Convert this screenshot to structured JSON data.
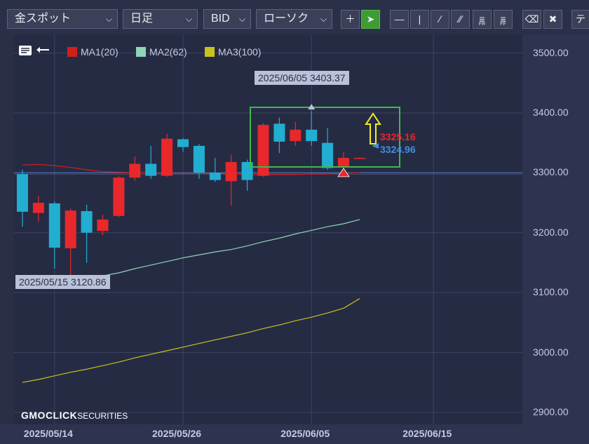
{
  "toolbar": {
    "symbol_select": "金スポット",
    "timeframe_select": "日足",
    "price_type_select": "BID",
    "chart_style_select": "ローソク",
    "label_fr": "FR",
    "label_ff": "FF",
    "label_more": "テ"
  },
  "legend": [
    {
      "name": "MA1(20)",
      "color": "#d1201a"
    },
    {
      "name": "MA2(62)",
      "color": "#8fd3b9"
    },
    {
      "name": "MA3(100)",
      "color": "#c9c21a"
    }
  ],
  "annotations": {
    "high_tooltip": "2025/06/05 3403.37",
    "low_tooltip": "2025/05/15 3120.86",
    "ask_price": "3325.16",
    "bid_price": "3324.96"
  },
  "logo": {
    "brand": "GMOCLICK",
    "suffix": "SECURITIES"
  },
  "colors": {
    "up": "#e8282b",
    "down": "#22aed1",
    "highlight_box": "#3bbb4a",
    "arrow": "#f1ee2a"
  },
  "chart_data": {
    "type": "candlestick",
    "title": "",
    "ylim": [
      2880,
      3530
    ],
    "y_ticks": [
      "3500.00",
      "3400.00",
      "3300.00",
      "3200.00",
      "3100.00",
      "3000.00",
      "2900.00"
    ],
    "x_ticks": [
      "2025/05/14",
      "2025/05/26",
      "2025/06/05",
      "2025/06/15"
    ],
    "candles": [
      {
        "date": "2025/05/12",
        "open": 3298,
        "high": 3305,
        "low": 3210,
        "close": 3235
      },
      {
        "date": "2025/05/13",
        "open": 3233,
        "high": 3262,
        "low": 3218,
        "close": 3250
      },
      {
        "date": "2025/05/14",
        "open": 3249,
        "high": 3252,
        "low": 3140,
        "close": 3175
      },
      {
        "date": "2025/05/15",
        "open": 3174,
        "high": 3240,
        "low": 3121,
        "close": 3237
      },
      {
        "date": "2025/05/16",
        "open": 3236,
        "high": 3247,
        "low": 3150,
        "close": 3200
      },
      {
        "date": "2025/05/19",
        "open": 3203,
        "high": 3230,
        "low": 3196,
        "close": 3222
      },
      {
        "date": "2025/05/20",
        "open": 3228,
        "high": 3295,
        "low": 3226,
        "close": 3292
      },
      {
        "date": "2025/05/21",
        "open": 3292,
        "high": 3327,
        "low": 3287,
        "close": 3315
      },
      {
        "date": "2025/05/22",
        "open": 3315,
        "high": 3345,
        "low": 3290,
        "close": 3295
      },
      {
        "date": "2025/05/23",
        "open": 3295,
        "high": 3365,
        "low": 3293,
        "close": 3357
      },
      {
        "date": "2025/05/26",
        "open": 3356,
        "high": 3358,
        "low": 3335,
        "close": 3343
      },
      {
        "date": "2025/05/27",
        "open": 3345,
        "high": 3348,
        "low": 3290,
        "close": 3300
      },
      {
        "date": "2025/05/28",
        "open": 3300,
        "high": 3325,
        "low": 3285,
        "close": 3288
      },
      {
        "date": "2025/05/29",
        "open": 3286,
        "high": 3330,
        "low": 3245,
        "close": 3318
      },
      {
        "date": "2025/05/30",
        "open": 3318,
        "high": 3322,
        "low": 3270,
        "close": 3288
      },
      {
        "date": "2025/06/02",
        "open": 3295,
        "high": 3383,
        "low": 3293,
        "close": 3380
      },
      {
        "date": "2025/06/03",
        "open": 3382,
        "high": 3392,
        "low": 3333,
        "close": 3352
      },
      {
        "date": "2025/06/04",
        "open": 3353,
        "high": 3385,
        "low": 3345,
        "close": 3372
      },
      {
        "date": "2025/06/05",
        "open": 3372,
        "high": 3403.37,
        "low": 3345,
        "close": 3353
      },
      {
        "date": "2025/06/06",
        "open": 3350,
        "high": 3375,
        "low": 3305,
        "close": 3308
      },
      {
        "date": "2025/06/09",
        "open": 3310,
        "high": 3335,
        "low": 3300,
        "close": 3325
      },
      {
        "date": "2025/06/10",
        "open": 3325,
        "high": 3326,
        "low": 3324,
        "close": 3325
      }
    ],
    "series": [
      {
        "name": "MA1(20)",
        "color": "#d1201a",
        "values": [
          3313,
          3314,
          3312,
          3309,
          3305,
          3302,
          3301,
          3300,
          3300,
          3299,
          3299,
          3299,
          3299,
          3298,
          3297,
          3297,
          3297,
          3297,
          3298,
          3298,
          3299,
          3300
        ]
      },
      {
        "name": "MA2(62)",
        "color": "#8fd3b9",
        "values": [
          3110,
          3112,
          3117,
          3120,
          3124,
          3128,
          3133,
          3140,
          3146,
          3152,
          3158,
          3163,
          3168,
          3172,
          3178,
          3185,
          3191,
          3198,
          3204,
          3210,
          3215,
          3222
        ]
      },
      {
        "name": "MA3(100)",
        "color": "#c9c21a",
        "values": [
          2950,
          2955,
          2961,
          2967,
          2972,
          2978,
          2984,
          2991,
          2997,
          3003,
          3009,
          3015,
          3021,
          3027,
          3033,
          3040,
          3046,
          3053,
          3059,
          3066,
          3074,
          3090
        ]
      }
    ],
    "grid": true,
    "price_line": 3300
  }
}
